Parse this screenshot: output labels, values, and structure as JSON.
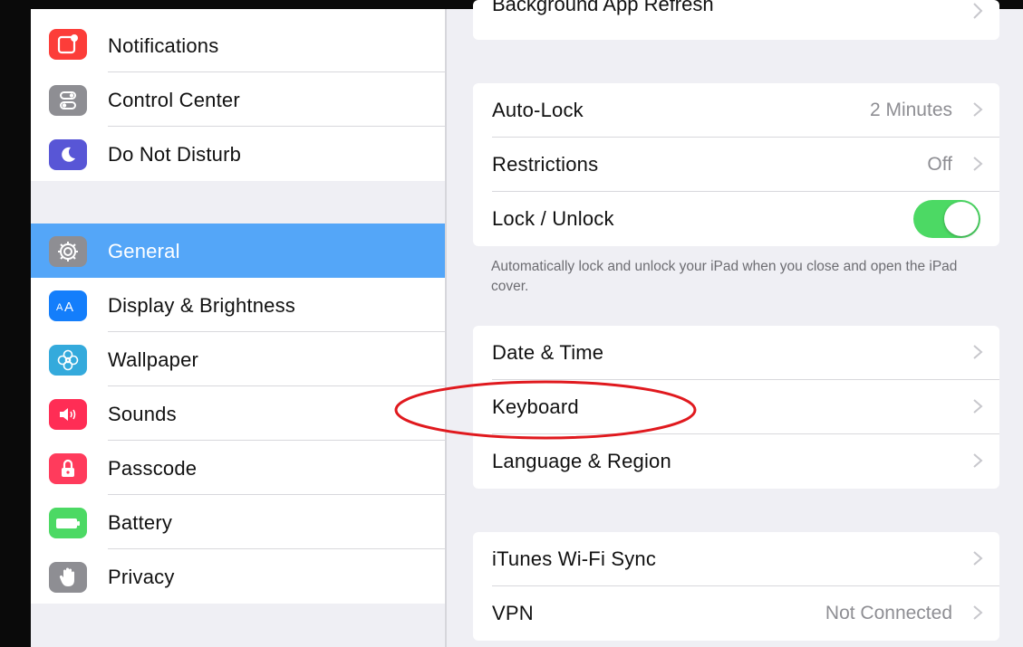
{
  "sidebar": {
    "group1": [
      {
        "label": "Notifications",
        "icon": "notifications-icon",
        "color": "#fc3d39"
      },
      {
        "label": "Control Center",
        "icon": "control-center-icon",
        "color": "#8e8e93"
      },
      {
        "label": "Do Not Disturb",
        "icon": "moon-icon",
        "color": "#5856d6"
      }
    ],
    "group2": [
      {
        "label": "General",
        "icon": "gear-icon",
        "color": "#8e8e93",
        "selected": true
      },
      {
        "label": "Display & Brightness",
        "icon": "display-aa-icon",
        "color": "#147efb"
      },
      {
        "label": "Wallpaper",
        "icon": "flower-icon",
        "color": "#34aadc"
      },
      {
        "label": "Sounds",
        "icon": "speaker-icon",
        "color": "#ff2d55"
      },
      {
        "label": "Passcode",
        "icon": "lock-icon",
        "color": "#ff3b5c"
      },
      {
        "label": "Battery",
        "icon": "battery-icon",
        "color": "#4cd964"
      },
      {
        "label": "Privacy",
        "icon": "hand-icon",
        "color": "#8e8e93"
      }
    ]
  },
  "main": {
    "top_cut_row": "Background App Refresh",
    "lock_group": {
      "auto_lock": {
        "title": "Auto-Lock",
        "value": "2 Minutes"
      },
      "restrictions": {
        "title": "Restrictions",
        "value": "Off"
      },
      "lock_unlock": {
        "title": "Lock / Unlock",
        "toggle": true
      }
    },
    "lock_footnote": "Automatically lock and unlock your iPad when you close and open the iPad cover.",
    "locale_group": [
      {
        "title": "Date & Time"
      },
      {
        "title": "Keyboard"
      },
      {
        "title": "Language & Region"
      }
    ],
    "sync_group": {
      "itunes": {
        "title": "iTunes Wi-Fi Sync"
      },
      "vpn": {
        "title": "VPN",
        "value": "Not Connected"
      }
    }
  },
  "colors": {
    "selection": "#54a6f8",
    "toggle_on": "#4cd964",
    "annotation": "#e0191e",
    "background": "#efeff4"
  }
}
